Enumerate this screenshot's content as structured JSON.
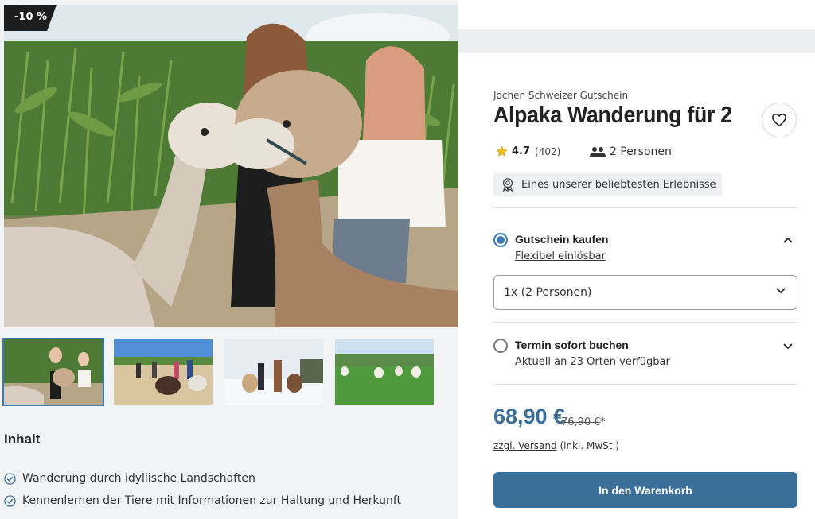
{
  "hero": {
    "discount_badge": "-10 %"
  },
  "thumbnails": [
    {
      "name": "thumbnail-alpaca-cornfield"
    },
    {
      "name": "thumbnail-group-walk"
    },
    {
      "name": "thumbnail-winter-walk"
    },
    {
      "name": "thumbnail-alpaca-meadow"
    }
  ],
  "inhalt": {
    "title": "Inhalt",
    "items": [
      "Wanderung durch idyllische Landschaften",
      "Kennenlernen der Tiere mit Informationen zur Haltung und Herkunft"
    ]
  },
  "product": {
    "brand": "Jochen Schweizer Gutschein",
    "title": "Alpaka Wanderung für 2",
    "rating_score": "4.7",
    "rating_count": "(402)",
    "persons": "2 Personen",
    "popular_badge": "Eines unserer beliebtesten Erlebnisse"
  },
  "options": {
    "voucher": {
      "label": "Gutschein kaufen",
      "sub": "Flexibel einlösbar",
      "selected": true,
      "quantity_select": "1x (2 Personen)"
    },
    "booking": {
      "label": "Termin sofort buchen",
      "sub": "Aktuell an 23 Orten verfügbar",
      "selected": false
    }
  },
  "pricing": {
    "price": "68,90 €",
    "old_price": "76,90 €",
    "old_price_marker": "*",
    "shipping_link": "zzgl. Versand",
    "shipping_note": "(inkl. MwSt.)"
  },
  "cart_button": "In den Warenkorb",
  "colors": {
    "accent": "#3a6f9a",
    "radio_selected": "#3a7bb6",
    "star": "#f3c316"
  }
}
